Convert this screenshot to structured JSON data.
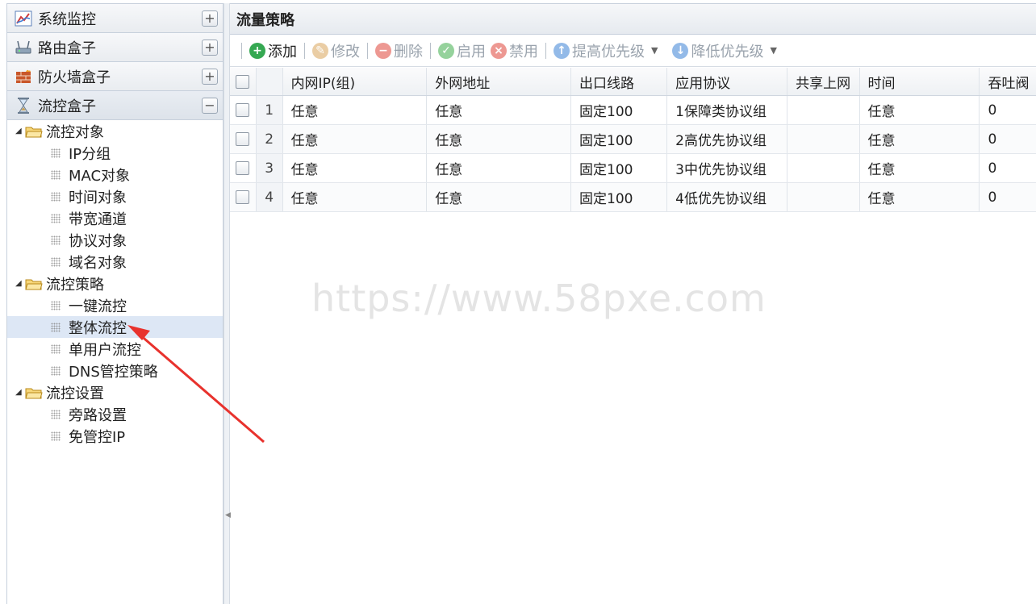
{
  "accordion": [
    {
      "label": "系统监控",
      "icon": "chart-icon",
      "toggle": "+"
    },
    {
      "label": "路由盒子",
      "icon": "router-icon",
      "toggle": "+"
    },
    {
      "label": "防火墙盒子",
      "icon": "firewall-icon",
      "toggle": "+"
    },
    {
      "label": "流控盒子",
      "icon": "hourglass-icon",
      "toggle": "−"
    }
  ],
  "tree": {
    "groups": [
      {
        "label": "流控对象",
        "items": [
          "IP分组",
          "MAC对象",
          "时间对象",
          "带宽通道",
          "协议对象",
          "域名对象"
        ]
      },
      {
        "label": "流控策略",
        "items": [
          "一键流控",
          "整体流控",
          "单用户流控",
          "DNS管控策略"
        ]
      },
      {
        "label": "流控设置",
        "items": [
          "旁路设置",
          "免管控IP"
        ]
      }
    ],
    "selected": "整体流控"
  },
  "panel": {
    "title": "流量策略"
  },
  "toolbar": {
    "add": "添加",
    "edit": "修改",
    "delete": "删除",
    "enable": "启用",
    "disable": "禁用",
    "raise": "提高优先级",
    "lower": "降低优先级"
  },
  "grid": {
    "columns": [
      "内网IP(组)",
      "外网地址",
      "出口线路",
      "应用协议",
      "共享上网",
      "时间",
      "吞吐阀"
    ],
    "rows": [
      {
        "num": "1",
        "ip": "任意",
        "wan": "任意",
        "line": "固定100",
        "proto": "1保障类协议组",
        "share": "",
        "time": "任意",
        "tp": "0"
      },
      {
        "num": "2",
        "ip": "任意",
        "wan": "任意",
        "line": "固定100",
        "proto": "2高优先协议组",
        "share": "",
        "time": "任意",
        "tp": "0"
      },
      {
        "num": "3",
        "ip": "任意",
        "wan": "任意",
        "line": "固定100",
        "proto": "3中优先协议组",
        "share": "",
        "time": "任意",
        "tp": "0"
      },
      {
        "num": "4",
        "ip": "任意",
        "wan": "任意",
        "line": "固定100",
        "proto": "4低优先协议组",
        "share": "",
        "time": "任意",
        "tp": "0"
      }
    ]
  },
  "watermark": "https://www.58pxe.com",
  "colors": {
    "accent_red": "#e8322d",
    "selected_bg": "#dde7f5",
    "add_green": "#35a852"
  }
}
